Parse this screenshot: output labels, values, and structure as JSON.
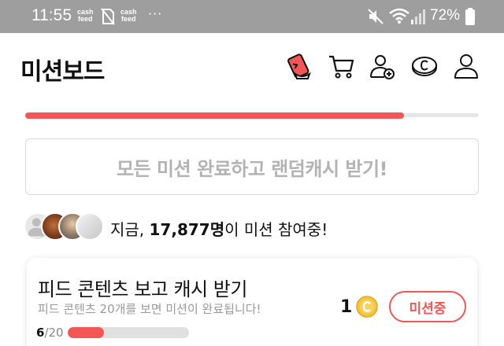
{
  "status_bar": {
    "time": "11:55",
    "notif_app_label_top": "cash",
    "notif_app_label_bottom": "feed",
    "overflow_dots": "···",
    "battery_percent": "72%"
  },
  "header": {
    "title": "미션보드",
    "icons": [
      "ticket-icon",
      "cart-icon",
      "add-friend-icon",
      "cash-coin-icon",
      "profile-icon"
    ]
  },
  "progress": {
    "fraction": 0.835
  },
  "reward_banner": {
    "label": "모든 미션 완료하고 랜덤캐시 받기!"
  },
  "participants": {
    "prefix": "지금, ",
    "count": "17,877명",
    "suffix": "이 미션 참여중!"
  },
  "missions": [
    {
      "title": "피드 콘텐츠 보고 캐시 받기",
      "description": "피드 콘텐츠 20개를 보면 미션이 완료됩니다!",
      "progress_current": "6",
      "progress_total": "/20",
      "progress_fraction": 0.3,
      "reward_amount": "1",
      "status_label": "미션중"
    }
  ],
  "colors": {
    "accent": "#f25656",
    "status_bar": "#9e9e9e",
    "muted_text": "#b3b3b3",
    "coin": "#f5c542"
  }
}
